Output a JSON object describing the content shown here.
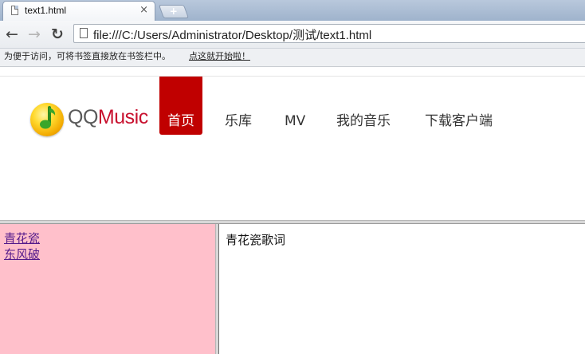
{
  "browser": {
    "tab_title": "text1.html",
    "tab_close": "×",
    "new_tab": "+",
    "back_icon": "←",
    "forward_icon": "→",
    "reload_icon": "↻",
    "url": "file:///C:/Users/Administrator/Desktop/测试/text1.html",
    "bookmark_prompt": "为便于访问，可将书签直接放在书签栏中。",
    "bookmark_link": "点这就开始啦！"
  },
  "site": {
    "logo_qq": "QQ",
    "logo_music": "Music",
    "nav": [
      {
        "label": "首页",
        "active": true
      },
      {
        "label": "乐库",
        "active": false
      },
      {
        "label": "MV",
        "active": false
      },
      {
        "label": "我的音乐",
        "active": false
      },
      {
        "label": "下载客户端",
        "active": false
      }
    ]
  },
  "left_frame": {
    "links": [
      "青花瓷",
      "东风破"
    ]
  },
  "right_frame": {
    "content": "青花瓷歌词"
  },
  "colors": {
    "active_nav": "#c00000",
    "left_frame_bg": "#ffc0cb",
    "logo_red": "#c8102e",
    "link_visited": "#551a8b"
  }
}
